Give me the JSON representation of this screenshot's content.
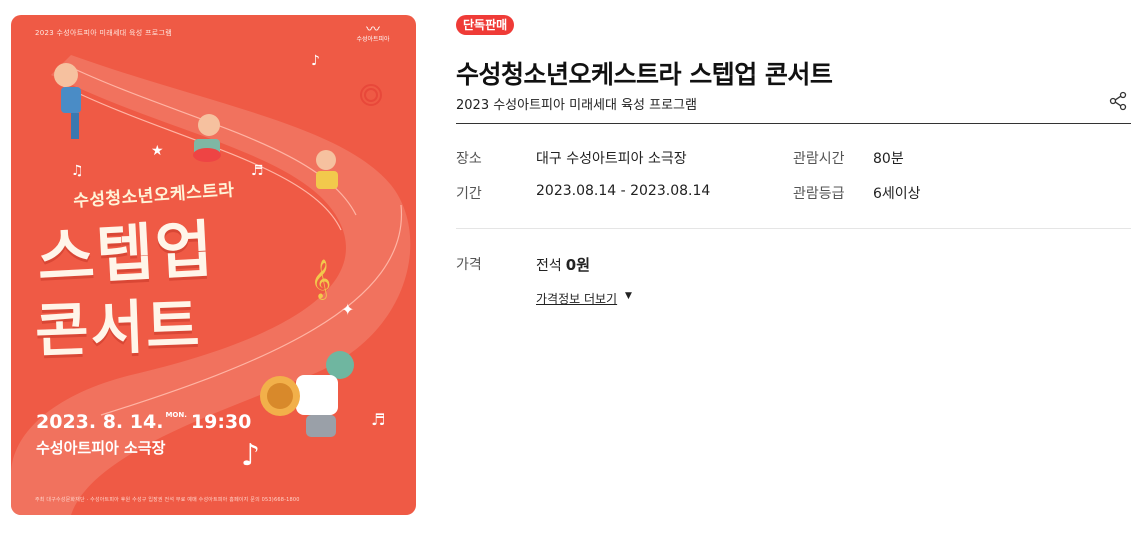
{
  "poster": {
    "top_caption": "2023 수성아트피아 미래세대 육성 프로그램",
    "logo_text": "수성아트피아",
    "orchestra_text": "수성청소년오케스트라",
    "big_line1": "스텝업",
    "big_line2": "콘서트",
    "date": "2023. 8. 14.",
    "day": "MON.",
    "time": "19:30",
    "venue": "수성아트피아 소극장",
    "footer": "주최 대구수성문화재단 · 수성아트피아   후원 수성구   입장권 전석 무료   예매 수성아트피아 홈페이지   문의 053)668-1800"
  },
  "badge": "단독판매",
  "title": "수성청소년오케스트라 스텝업 콘서트",
  "subtitle": "2023 수성아트피아 미래세대 육성 프로그램",
  "info": {
    "venue_label": "장소",
    "venue_value": "대구 수성아트피아 소극장",
    "period_label": "기간",
    "period_value": "2023.08.14 - 2023.08.14",
    "runtime_label": "관람시간",
    "runtime_value": "80분",
    "rating_label": "관람등급",
    "rating_value": "6세이상"
  },
  "price": {
    "label": "가격",
    "seat": "전석",
    "amount": "0원",
    "more_link": "가격정보 더보기",
    "more_icon": "caret-down-icon"
  },
  "colors": {
    "poster_bg": "#ef5a45",
    "badge_bg": "#ef3b37"
  }
}
